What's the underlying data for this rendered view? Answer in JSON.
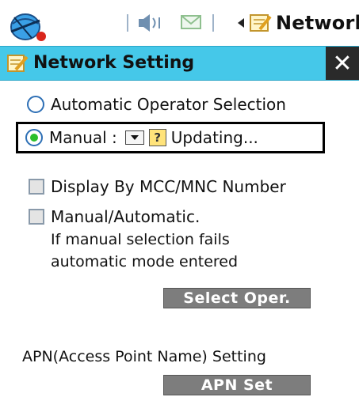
{
  "taskbar": {
    "app_title": "Network",
    "start_icon": "globe-start-icon",
    "volume_icon": "volume-icon",
    "mail_icon": "envelope-icon",
    "back_icon": "back-arrow-icon",
    "network_icon": "network-notepad-icon"
  },
  "window": {
    "title": "Network Setting",
    "close_label": "✕",
    "title_icon": "notepad-icon"
  },
  "options": {
    "automatic_label": "Automatic Operator Selection",
    "manual_label": "Manual :",
    "manual_selected": true,
    "updating_label": "Updating...",
    "display_mcc_label": "Display By MCC/MNC Number",
    "manual_auto_label": "Manual/Automatic.",
    "manual_auto_desc_line1": "If manual selection fails",
    "manual_auto_desc_line2": "automatic mode entered",
    "select_oper_button": "Select Oper."
  },
  "apn": {
    "heading": "APN(Access Point Name) Setting",
    "button_label": "APN Set"
  },
  "colors": {
    "titlebar": "#45c8e9",
    "close_button": "#2a2a2a",
    "button_bg": "#7d7d7d",
    "radio_on": "#2bbf2b"
  }
}
